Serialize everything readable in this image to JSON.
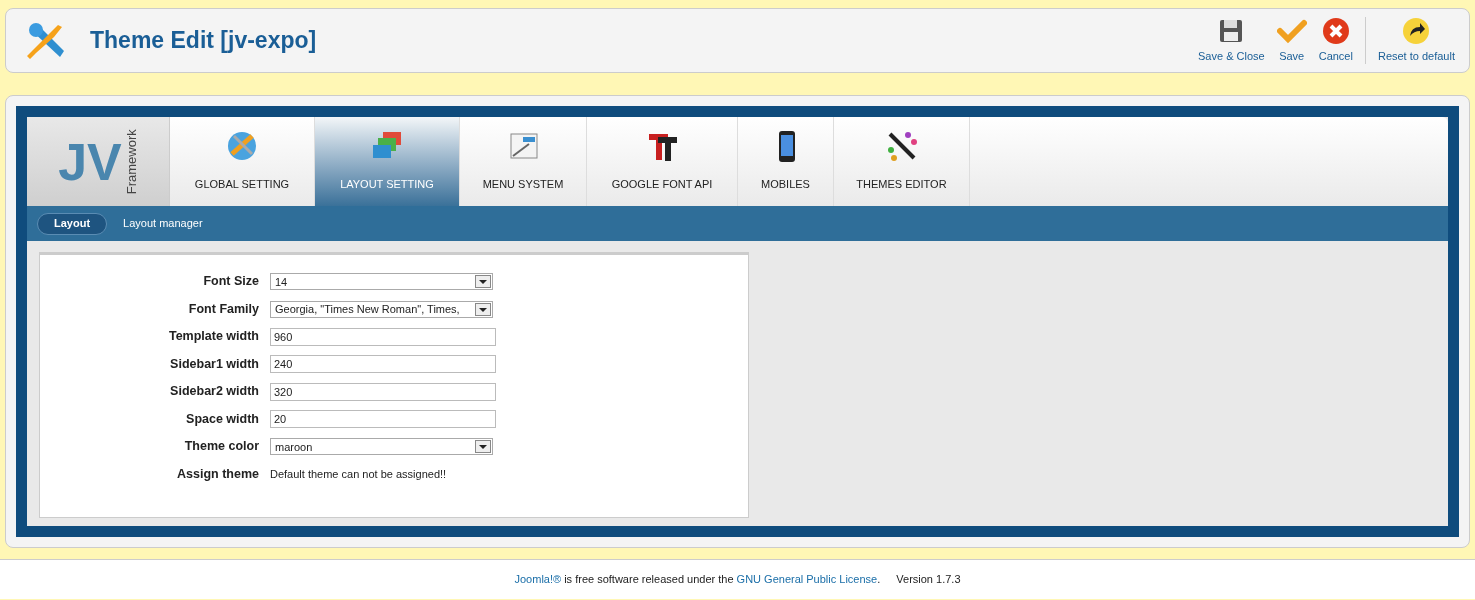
{
  "header": {
    "title": "Theme Edit [jv-expo]"
  },
  "toolbar": [
    {
      "kind": "save-close",
      "label": "Save & Close"
    },
    {
      "kind": "save",
      "label": "Save"
    },
    {
      "kind": "cancel",
      "label": "Cancel"
    },
    {
      "kind": "reset",
      "label": "Reset to default"
    }
  ],
  "logo": {
    "letters": "JV",
    "word": "Framework"
  },
  "tabs": [
    {
      "kind": "globe",
      "label": "GLOBAL SETTING",
      "selected": false
    },
    {
      "kind": "layout",
      "label": "LAYOUT SETTING",
      "selected": true
    },
    {
      "kind": "menu",
      "label": "MENU SYSTEM",
      "selected": false
    },
    {
      "kind": "font",
      "label": "GOOGLE FONT API",
      "selected": false
    },
    {
      "kind": "phone",
      "label": "MOBILES",
      "selected": false
    },
    {
      "kind": "palette",
      "label": "THEMES EDITOR",
      "selected": false
    }
  ],
  "subtabs": [
    {
      "label": "Layout",
      "selected": true
    },
    {
      "label": "Layout manager",
      "selected": false
    }
  ],
  "form": [
    {
      "kind": "select",
      "label": "Font Size",
      "value": "14"
    },
    {
      "kind": "select",
      "label": "Font Family",
      "value": "Georgia, \"Times New Roman\", Times,"
    },
    {
      "kind": "text",
      "label": "Template width",
      "value": "960"
    },
    {
      "kind": "text",
      "label": "Sidebar1 width",
      "value": "240"
    },
    {
      "kind": "text",
      "label": "Sidebar2 width",
      "value": "320"
    },
    {
      "kind": "text",
      "label": "Space width",
      "value": "20"
    },
    {
      "kind": "select",
      "label": "Theme color",
      "value": "maroon"
    },
    {
      "kind": "note",
      "label": "Assign theme",
      "value": "Default theme can not be assigned!!"
    }
  ],
  "footer": {
    "link1": "Joomla!®",
    "text1": "is free software released under the",
    "link2": "GNU General Public License",
    "text2": ".",
    "version": "Version 1.7.3"
  }
}
